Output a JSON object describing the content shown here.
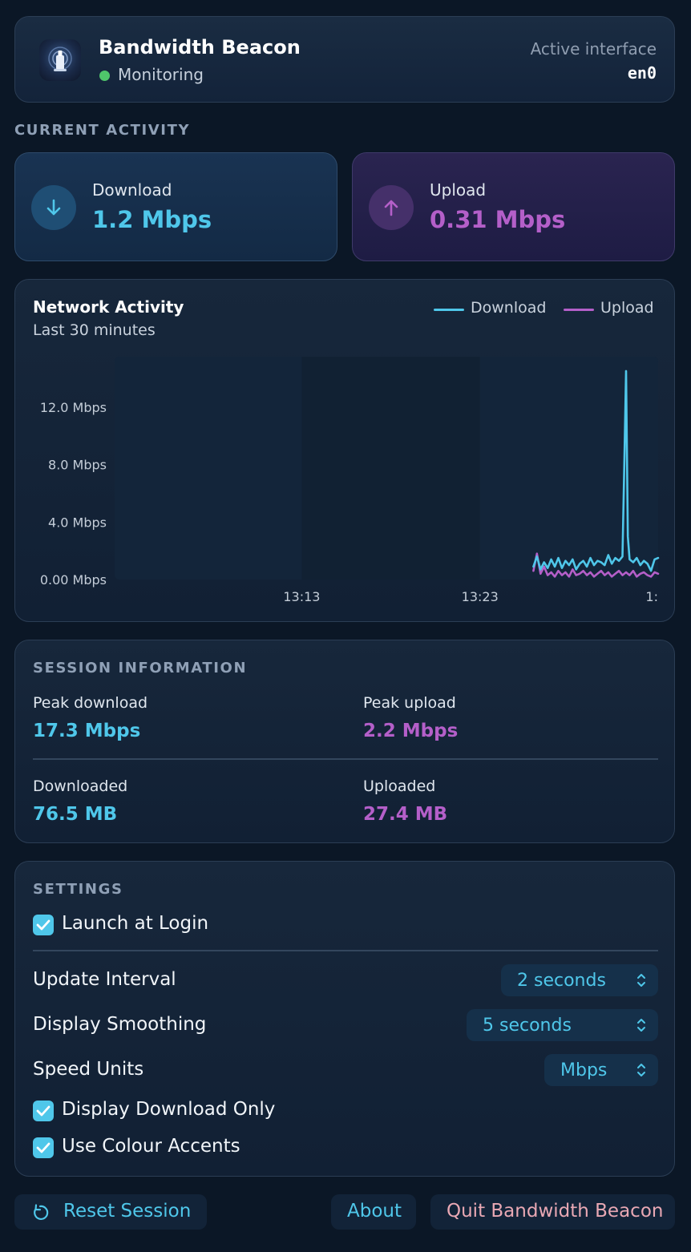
{
  "header": {
    "app_title": "Bandwidth Beacon",
    "status": "Monitoring",
    "status_color": "#4fc56b",
    "interface_label": "Active interface",
    "interface_value": "en0"
  },
  "current_activity": {
    "section_label": "CURRENT ACTIVITY",
    "download": {
      "label": "Download",
      "value": "1.2 Mbps",
      "icon": "arrow-down-icon",
      "color": "#4fc7ea"
    },
    "upload": {
      "label": "Upload",
      "value": "0.31 Mbps",
      "icon": "arrow-up-icon",
      "color": "#b45fc9"
    }
  },
  "chart": {
    "title": "Network Activity",
    "subtitle": "Last 30 minutes",
    "legend": {
      "download": "Download",
      "upload": "Upload"
    }
  },
  "chart_data": {
    "type": "line",
    "title": "Network Activity",
    "subtitle": "Last 30 minutes",
    "ylim": [
      0,
      15.5
    ],
    "y_ticks": [
      {
        "value": 0,
        "label": "0.00 Mbps"
      },
      {
        "value": 4,
        "label": "4.0 Mbps"
      },
      {
        "value": 8,
        "label": "8.0 Mbps"
      },
      {
        "value": 12,
        "label": "12.0 Mbps"
      }
    ],
    "x_ticks": [
      {
        "value": 10,
        "label": "13:13"
      },
      {
        "value": 20,
        "label": "13:23"
      },
      {
        "value": 30,
        "label": "1:"
      }
    ],
    "xlim": [
      -0.5,
      30
    ],
    "grid": true,
    "legend_position": "top-right",
    "series": [
      {
        "name": "Download",
        "color": "#4fc7ea",
        "x": [
          23.0,
          23.2,
          23.4,
          23.6,
          23.8,
          24.0,
          24.2,
          24.4,
          24.6,
          24.8,
          25.0,
          25.2,
          25.4,
          25.6,
          25.8,
          26.0,
          26.2,
          26.4,
          26.6,
          26.8,
          27.0,
          27.2,
          27.4,
          27.6,
          27.8,
          28.0,
          28.1,
          28.2,
          28.3,
          28.4,
          28.6,
          28.8,
          29.0,
          29.2,
          29.4,
          29.6,
          29.8,
          30.0
        ],
        "values": [
          0.9,
          1.6,
          0.7,
          1.2,
          0.8,
          1.4,
          0.9,
          1.5,
          0.8,
          1.3,
          1.0,
          1.4,
          0.7,
          1.1,
          1.3,
          0.9,
          1.5,
          1.0,
          1.3,
          1.2,
          1.0,
          1.7,
          1.1,
          1.5,
          1.3,
          1.6,
          8.0,
          14.5,
          3.0,
          1.4,
          1.2,
          1.5,
          1.0,
          1.3,
          1.1,
          0.6,
          1.4,
          1.5
        ]
      },
      {
        "name": "Upload",
        "color": "#b45fc9",
        "x": [
          23.0,
          23.2,
          23.4,
          23.6,
          23.8,
          24.0,
          24.2,
          24.4,
          24.6,
          24.8,
          25.0,
          25.2,
          25.4,
          25.6,
          25.8,
          26.0,
          26.2,
          26.4,
          26.6,
          26.8,
          27.0,
          27.2,
          27.4,
          27.6,
          27.8,
          28.0,
          28.2,
          28.4,
          28.6,
          28.8,
          29.0,
          29.2,
          29.4,
          29.6,
          29.8,
          30.0
        ],
        "values": [
          0.6,
          1.8,
          0.4,
          0.9,
          0.3,
          0.5,
          0.2,
          0.6,
          0.3,
          0.5,
          0.2,
          0.7,
          0.3,
          0.4,
          0.6,
          0.3,
          0.5,
          0.2,
          0.4,
          0.6,
          0.3,
          0.5,
          0.2,
          0.4,
          0.6,
          0.3,
          0.5,
          0.3,
          0.6,
          0.2,
          0.4,
          0.5,
          0.3,
          0.2,
          0.5,
          0.4
        ]
      }
    ]
  },
  "session": {
    "section_label": "SESSION INFORMATION",
    "peak_download_label": "Peak download",
    "peak_download_value": "17.3 Mbps",
    "peak_upload_label": "Peak upload",
    "peak_upload_value": "2.2 Mbps",
    "downloaded_label": "Downloaded",
    "downloaded_value": "76.5 MB",
    "uploaded_label": "Uploaded",
    "uploaded_value": "27.4 MB"
  },
  "settings": {
    "section_label": "SETTINGS",
    "launch_at_login": {
      "label": "Launch at Login",
      "checked": true
    },
    "update_interval": {
      "label": "Update Interval",
      "value": "2 seconds"
    },
    "display_smoothing": {
      "label": "Display Smoothing",
      "value": "5 seconds"
    },
    "speed_units": {
      "label": "Speed Units",
      "value": "Mbps"
    },
    "display_download_only": {
      "label": "Display Download Only",
      "checked": true
    },
    "use_colour_accents": {
      "label": "Use Colour Accents",
      "checked": true
    },
    "accent_color": "#4fc7ea"
  },
  "footer": {
    "reset_label": "Reset Session",
    "about_label": "About",
    "quit_label": "Quit Bandwidth Beacon",
    "quit_color": "#e9a8b4"
  }
}
